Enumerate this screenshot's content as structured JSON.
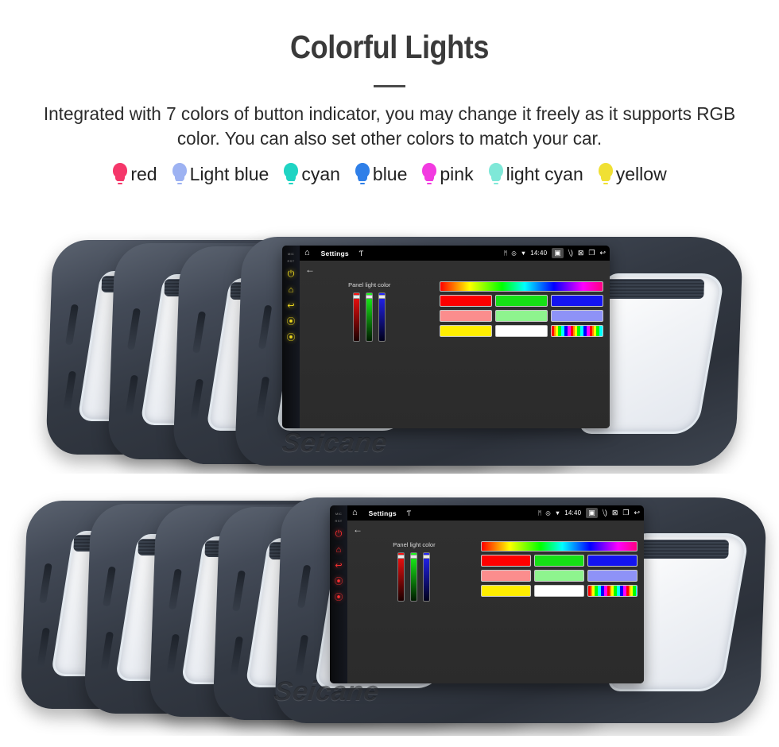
{
  "header": {
    "title": "Colorful Lights",
    "description": "Integrated with 7 colors of button indicator, you may change it freely as it supports RGB color. You can also set other colors to match your car."
  },
  "legend": {
    "items": [
      {
        "label": "red",
        "color": "#f5376a",
        "icon": "bulb-icon"
      },
      {
        "label": "Light blue",
        "color": "#9db2f2",
        "icon": "bulb-icon"
      },
      {
        "label": "cyan",
        "color": "#1fd4c3",
        "icon": "bulb-icon"
      },
      {
        "label": "blue",
        "color": "#2f7fe8",
        "icon": "bulb-icon"
      },
      {
        "label": "pink",
        "color": "#f23ae0",
        "icon": "bulb-icon"
      },
      {
        "label": "light cyan",
        "color": "#7fe8d8",
        "icon": "bulb-icon"
      },
      {
        "label": "yellow",
        "color": "#f0e034",
        "icon": "bulb-icon"
      }
    ]
  },
  "unit_screen": {
    "statusbar": {
      "home_icon": "home-icon",
      "title": "Settings",
      "mic_icon": "microphone-icon",
      "bluetooth_icon": "bluetooth-icon",
      "location_icon": "location-icon",
      "wifi_icon": "wifi-icon",
      "time": "14:40",
      "screenshot_icon": "camera-icon",
      "volume_icon": "volume-icon",
      "close_icon": "close-box-icon",
      "recents_icon": "recents-icon",
      "back_icon": "back-arrow-icon"
    },
    "content": {
      "back_icon": "back-arrow-icon",
      "panel_label": "Panel light color",
      "sliders": [
        {
          "name": "red-slider",
          "gradient_top": "#ff1010",
          "gradient_bottom": "#1a0000",
          "thumb_pct": 4
        },
        {
          "name": "green-slider",
          "gradient_top": "#19ff19",
          "gradient_bottom": "#001a00",
          "thumb_pct": 4
        },
        {
          "name": "blue-slider",
          "gradient_top": "#2424ff",
          "gradient_bottom": "#000018",
          "thumb_pct": 4
        }
      ],
      "hue_bar": "rainbow-gradient-bar",
      "swatches": [
        [
          {
            "name": "swatch-red",
            "color": "#ff0000"
          },
          {
            "name": "swatch-green",
            "color": "#16e016"
          },
          {
            "name": "swatch-blue",
            "color": "#1414f0"
          }
        ],
        [
          {
            "name": "swatch-salmon",
            "color": "#fb8d8d"
          },
          {
            "name": "swatch-lightgreen",
            "color": "#8ef48e"
          },
          {
            "name": "swatch-periwinkle",
            "color": "#8e92f7"
          }
        ],
        [
          {
            "name": "swatch-yellow",
            "color": "#ffee00"
          },
          {
            "name": "swatch-white",
            "color": "#ffffff"
          },
          {
            "name": "swatch-rainbow",
            "color": "rainbow"
          }
        ]
      ]
    },
    "sidebar": {
      "mic_label": "MIC",
      "rst_label": "RST",
      "buttons": [
        {
          "name": "power-button",
          "glyph": "⏻"
        },
        {
          "name": "home-button",
          "glyph": "⌂"
        },
        {
          "name": "back-button",
          "glyph": "↩"
        },
        {
          "name": "volume-down-button",
          "glyph": "⦿"
        },
        {
          "name": "volume-up-button",
          "glyph": "⦿"
        }
      ]
    }
  },
  "photo_top": {
    "caption_watermark": "Seicane",
    "unit_button_colors": [
      "#ffffff",
      "#35e04a",
      "#8a7cf5",
      "#f2dc1e"
    ]
  },
  "photo_bottom": {
    "caption_watermark": "Seicane",
    "unit_button_colors": [
      "#ffffff",
      "#ff2b2b",
      "#2bdb3f",
      "#2b6bff",
      "#ff3030"
    ]
  }
}
